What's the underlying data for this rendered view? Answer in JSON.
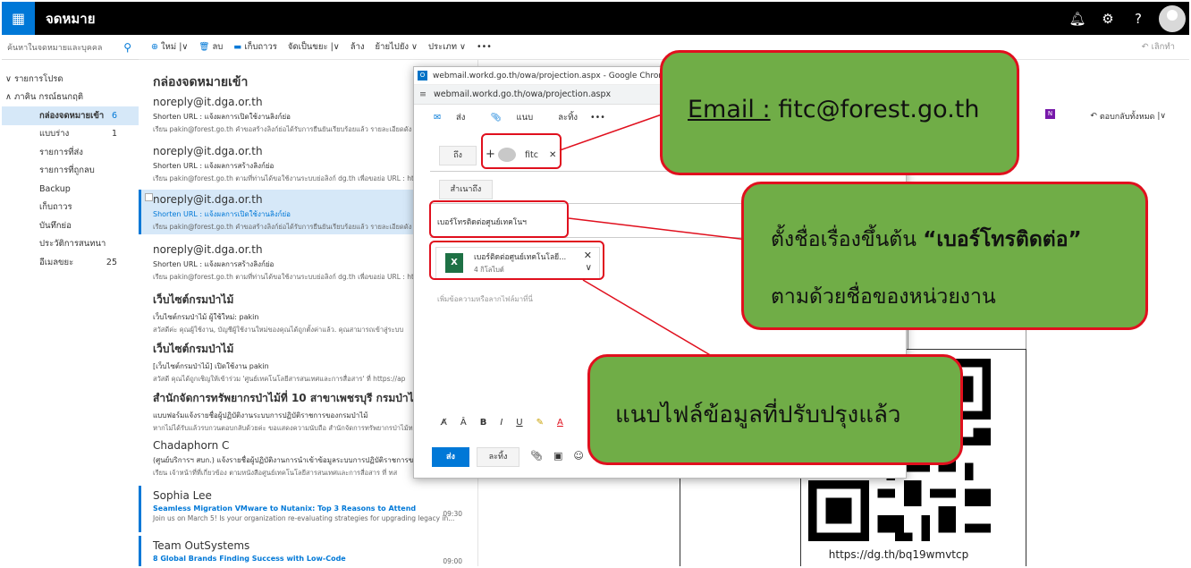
{
  "app": {
    "title": "จดหมาย"
  },
  "search": {
    "placeholder": "ค้นหาในจดหมายและบุคคล"
  },
  "folders": {
    "favorites": "รายการโปรด",
    "account": "ภาคิน กรณ์ธนกฤติ",
    "items": [
      {
        "label": "กล่องจดหมายเข้า",
        "count": "6"
      },
      {
        "label": "แบบร่าง",
        "count": "1"
      },
      {
        "label": "รายการที่ส่ง",
        "count": ""
      },
      {
        "label": "รายการที่ถูกลบ",
        "count": ""
      },
      {
        "label": "Backup",
        "count": ""
      },
      {
        "label": "เก็บถาวร",
        "count": ""
      },
      {
        "label": "บันทึกย่อ",
        "count": ""
      },
      {
        "label": "ประวัติการสนทนา",
        "count": ""
      },
      {
        "label": "อีเมลขยะ",
        "count": "25"
      }
    ]
  },
  "commands": {
    "new": "ใหม่",
    "delete": "ลบ",
    "archive": "เก็บถาวร",
    "junk": "จัดเป็นขยะ",
    "sweep": "ล้าง",
    "move": "ย้ายไปยัง",
    "categorize": "ประเภท",
    "more": "•••",
    "undo": "เลิกทำ"
  },
  "list": {
    "title": "กล่องจดหมายเข้า",
    "messages": [
      {
        "sender": "noreply@it.dga.or.th",
        "subject": "Shorten URL : แจ้งผลการเปิดใช้งานลิงก์ย่อ",
        "preview": "เรียน pakin@forest.go.th คำขอสร้างลิงก์ย่อได้รับการยืนยันเรียบร้อยแล้ว รายละเอียดดัง",
        "time": ""
      },
      {
        "sender": "noreply@it.dga.or.th",
        "subject": "Shorten URL : แจ้งผลการสร้างลิงก์ย่อ",
        "preview": "เรียน pakin@forest.go.th ตามที่ท่านได้ขอใช้งานระบบย่อลิงก์ dg.th เพื่อขอย่อ URL : ht",
        "time": ""
      },
      {
        "sender": "noreply@it.dga.or.th",
        "subject": "Shorten URL : แจ้งผลการเปิดใช้งานลิงก์ย่อ",
        "preview": "เรียน pakin@forest.go.th คำขอสร้างลิงก์ย่อได้รับการยืนยันเรียบร้อยแล้ว รายละเอียดดัง",
        "time": ""
      },
      {
        "sender": "noreply@it.dga.or.th",
        "subject": "Shorten URL : แจ้งผลการสร้างลิงก์ย่อ",
        "preview": "เรียน pakin@forest.go.th ตามที่ท่านได้ขอใช้งานระบบย่อลิงก์ dg.th เพื่อขอย่อ URL : ht",
        "time": ""
      },
      {
        "sender": "เว็บไซต์กรมป่าไม้",
        "subject": "เว็บไซต์กรมป่าไม้ ผู้ใช้ใหม่: pakin",
        "preview": "สวัสดีค่ะ คุณผู้ใช้งาน, บัญชีผู้ใช้งานใหม่ของคุณได้ถูกตั้งค่าแล้ว. คุณสามารถเข้าสู่ระบบ",
        "time": ""
      },
      {
        "sender": "เว็บไซต์กรมป่าไม้",
        "subject": "[เว็บไซต์กรมป่าไม้] เปิดใช้งาน pakin",
        "preview": "สวัสดี คุณได้ถูกเชิญให้เข้าร่วม 'ศูนย์เทคโนโลยีสารสนเทศและการสื่อสาร' ที่ https://ap",
        "time": ""
      },
      {
        "sender": "สำนักจัดการทรัพยากรป่าไม้ที่ 10 สาขาเพชรบุรี กรมป่าไม้",
        "subject": "แบบฟอร์มแจ้งรายชื่อผู้ปฏิบัติงานระบบการปฏิบัติราชการของกรมป่าไม้",
        "preview": "หากไม่ได้รับแล้วรบกวนตอบกลับด้วยค่ะ ขอแสดงความนับถือ สำนักจัดการทรัพยากรป่าไม้ท",
        "time": ""
      },
      {
        "sender": "Chadaphorn C",
        "subject": "(ศูนย์บริการฯ สบก.) แจ้งรายชื่อผู้ปฏิบัติงานการนำเข้าข้อมูลระบบการปฏิบัติราชการของ",
        "preview": "เรียน เจ้าหน้าที่ที่เกี่ยวข้อง ตามหนังสือศูนย์เทคโนโลยีสารสนเทศและการสื่อสาร ที่ ทส",
        "time": ""
      },
      {
        "sender": "Sophia Lee",
        "subject": "Seamless Migration VMware to Nutanix: Top 3 Reasons to Attend",
        "preview": "Join us on March 5! Is your organization re-evaluating strategies for upgrading legacy in...",
        "time": "09:30"
      },
      {
        "sender": "Team OutSystems",
        "subject": "8 Global Brands Finding Success with Low-Code",
        "preview": "",
        "time": "09:00"
      }
    ]
  },
  "popup": {
    "window_title": "webmail.workd.go.th/owa/projection.aspx - Google Chrome",
    "url": "webmail.workd.go.th/owa/projection.aspx",
    "send": "ส่ง",
    "attach": "แนบ",
    "discard": "ละทิ้ง",
    "more": "•••",
    "to_label": "ถึง",
    "cc_label": "สำเนาถึง",
    "recipient": "fitc",
    "subject": "เบอร์โทรติดต่อศูนย์เทคโนฯ",
    "attachment_name": "เบอร์ติดต่อศูนย์เทคโนโลยี...",
    "attachment_size": "4 กิโลไบต์",
    "body_placeholder": "เพิ่มข้อความหรือลากไฟล์มาที่นี่",
    "send_button": "ส่ง",
    "discard_button": "ละทิ้ง"
  },
  "reading": {
    "reply_all": "ตอบกลับทั้งหมด",
    "qr_url": "https://dg.th/bq19wmvtcp"
  },
  "callouts": {
    "email_label": "Email :",
    "email_value": "fitc@forest.go.th",
    "subject_line1_prefix": "ตั้งชื่อเรื่องขึ้นต้น ",
    "subject_line1_bold": "“เบอร์โทรติดต่อ”",
    "subject_line2": "ตามด้วยชื่อของหน่วยงาน",
    "attach_note": "แนบไฟล์ข้อมูลที่ปรับปรุงแล้ว"
  }
}
